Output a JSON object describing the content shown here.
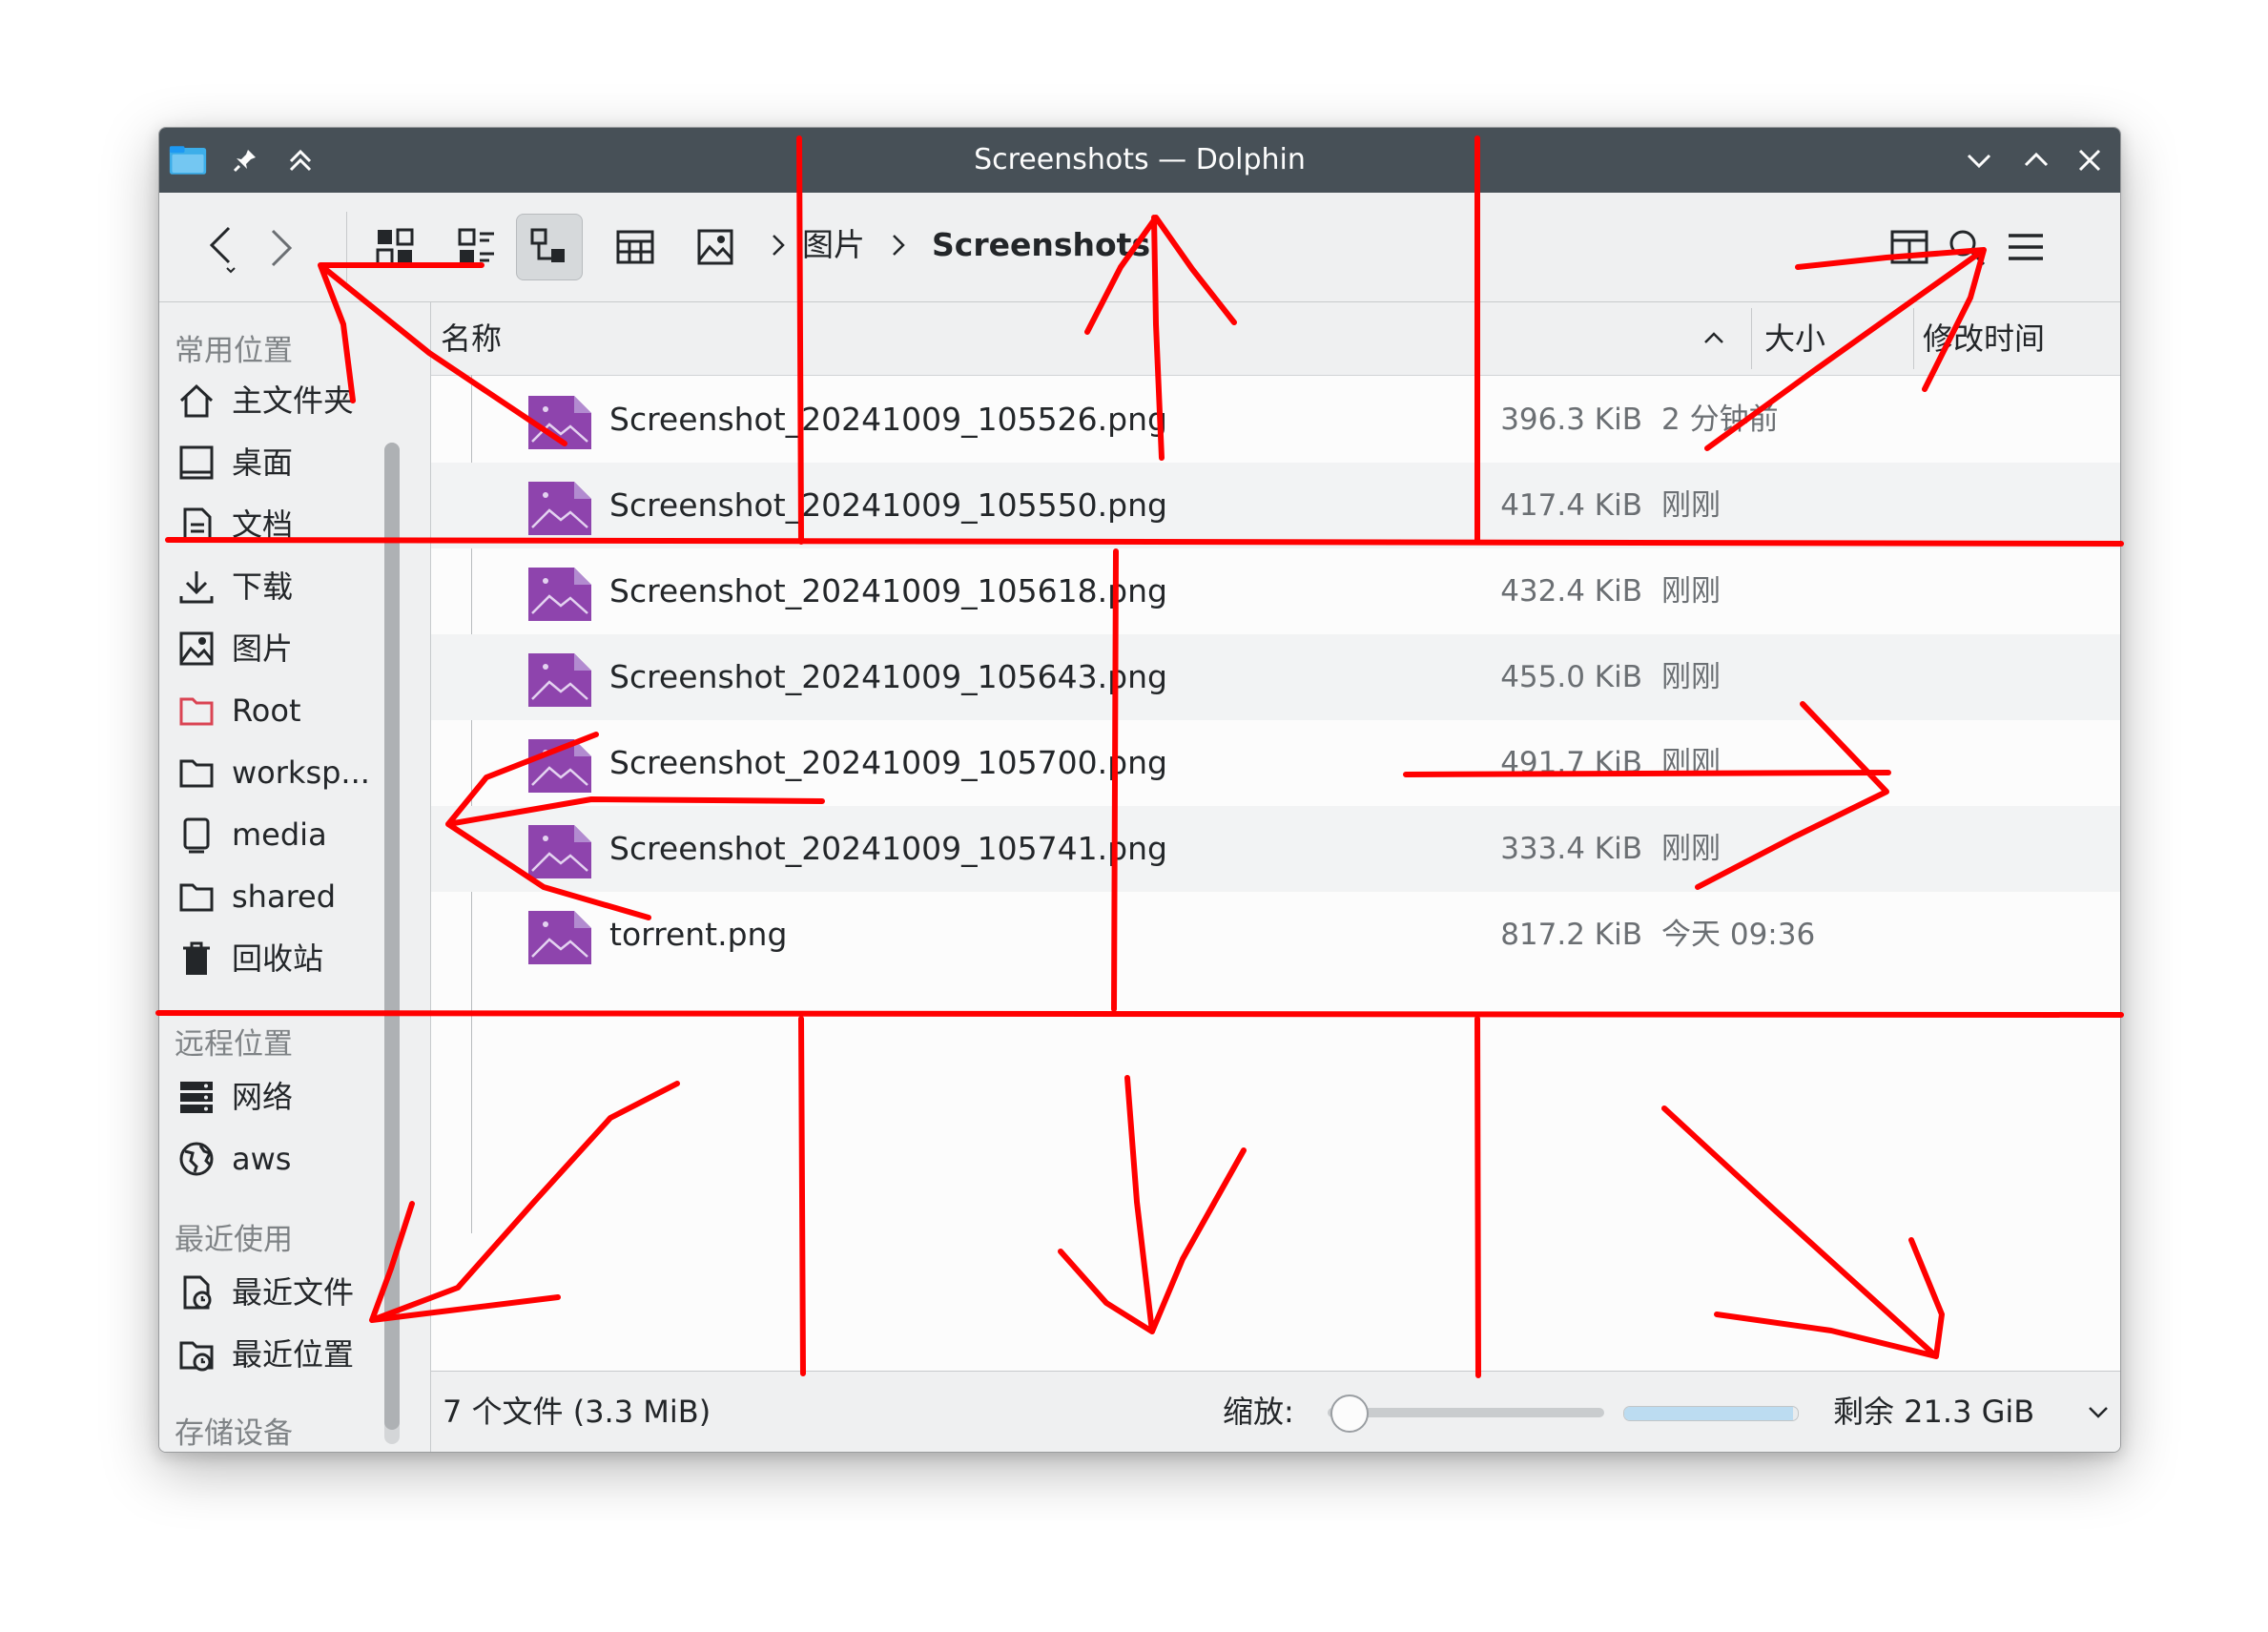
{
  "window": {
    "title": "Screenshots — Dolphin"
  },
  "toolbar": {
    "breadcrumb": [
      "图片",
      "Screenshots"
    ]
  },
  "sidebar": {
    "places_heading": "常用位置",
    "places": [
      {
        "label": "主文件夹",
        "icon": "home-icon"
      },
      {
        "label": "桌面",
        "icon": "desktop-icon"
      },
      {
        "label": "文档",
        "icon": "document-icon"
      },
      {
        "label": "下载",
        "icon": "download-icon"
      },
      {
        "label": "图片",
        "icon": "pictures-icon"
      },
      {
        "label": "Root",
        "icon": "root-folder-icon"
      },
      {
        "label": "worksp...",
        "icon": "folder-icon"
      },
      {
        "label": "media",
        "icon": "media-icon"
      },
      {
        "label": "shared",
        "icon": "folder-icon"
      },
      {
        "label": "回收站",
        "icon": "trash-icon"
      }
    ],
    "remote_heading": "远程位置",
    "remote": [
      {
        "label": "网络",
        "icon": "network-icon"
      },
      {
        "label": "aws",
        "icon": "globe-icon"
      }
    ],
    "recent_heading": "最近使用",
    "recent": [
      {
        "label": "最近文件",
        "icon": "recent-files-icon"
      },
      {
        "label": "最近位置",
        "icon": "recent-locations-icon"
      }
    ],
    "devices_heading": "存储设备"
  },
  "columns": {
    "name": "名称",
    "size": "大小",
    "modified": "修改时间"
  },
  "files": [
    {
      "name": "Screenshot_20241009_105526.png",
      "size": "396.3 KiB",
      "modified": "2 分钟前"
    },
    {
      "name": "Screenshot_20241009_105550.png",
      "size": "417.4 KiB",
      "modified": "刚刚"
    },
    {
      "name": "Screenshot_20241009_105618.png",
      "size": "432.4 KiB",
      "modified": "刚刚"
    },
    {
      "name": "Screenshot_20241009_105643.png",
      "size": "455.0 KiB",
      "modified": "刚刚"
    },
    {
      "name": "Screenshot_20241009_105700.png",
      "size": "491.7 KiB",
      "modified": "刚刚"
    },
    {
      "name": "Screenshot_20241009_105741.png",
      "size": "333.4 KiB",
      "modified": "刚刚"
    },
    {
      "name": "torrent.png",
      "size": "817.2 KiB",
      "modified": "今天 09:36"
    }
  ],
  "status": {
    "summary": "7 个文件 (3.3 MiB)",
    "zoom_label": "缩放:",
    "zoom_level": 0.08,
    "free_space": "剩余 21.3 GiB",
    "free_space_used_fraction": 0.97
  },
  "colors": {
    "titlebar": "#475057",
    "annotation": "#ff0000",
    "file_icon": "#8e44ad"
  }
}
